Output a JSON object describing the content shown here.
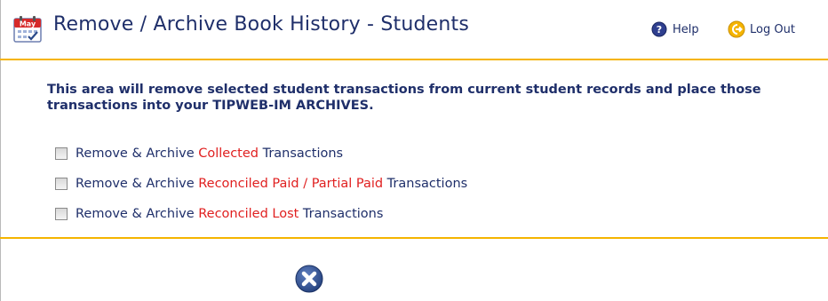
{
  "header": {
    "title": "Remove / Archive Book History - Students",
    "calendar_month": "May",
    "help_label": "Help",
    "logout_label": "Log Out"
  },
  "main": {
    "intro": "This area will remove selected student transactions from current student records and place those transactions into your TIPWEB-IM ARCHIVES.",
    "options": [
      {
        "prefix": "Remove & Archive ",
        "highlight": "Collected",
        "suffix": " Transactions",
        "checked": false
      },
      {
        "prefix": "Remove & Archive ",
        "highlight": "Reconciled Paid / Partial Paid",
        "suffix": " Transactions",
        "checked": false
      },
      {
        "prefix": "Remove & Archive ",
        "highlight": "Reconciled Lost",
        "suffix": " Transactions",
        "checked": false
      }
    ]
  },
  "colors": {
    "title": "#1f2f6a",
    "accent_rule": "#f5b400",
    "highlight": "#e02020",
    "cancel_button": "#2b4a8a"
  },
  "icons": {
    "calendar": "calendar-icon",
    "help": "help-icon",
    "logout": "logout-icon",
    "cancel": "close-icon"
  }
}
